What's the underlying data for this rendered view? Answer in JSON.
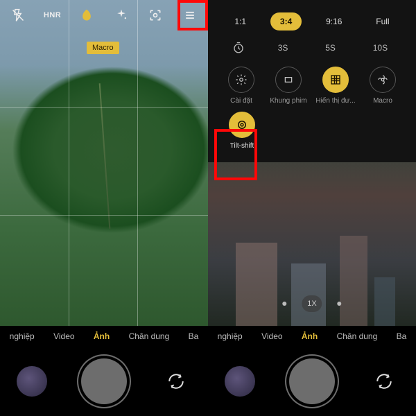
{
  "accent": "#e3bd3a",
  "left": {
    "top_icons": [
      "flash-off",
      "hdr",
      "leaf",
      "sparkle",
      "lens",
      "menu"
    ],
    "hdr_text": "HNR",
    "mode_badge": "Macro",
    "modes": [
      "nghiệp",
      "Video",
      "Ảnh",
      "Chân dung",
      "Ba"
    ],
    "active_mode": "Ảnh"
  },
  "right": {
    "ratios": [
      "1:1",
      "3:4",
      "9:16",
      "Full"
    ],
    "active_ratio": "3:4",
    "timers": [
      "3S",
      "5S",
      "10S"
    ],
    "options_row1": [
      {
        "key": "caidat",
        "label": "Cài đặt",
        "icon": "gear"
      },
      {
        "key": "khungphim",
        "label": "Khung phim",
        "icon": "frame"
      },
      {
        "key": "hienthi",
        "label": "Hiển thị đư...",
        "icon": "grid",
        "active": true
      },
      {
        "key": "macro",
        "label": "Macro",
        "icon": "flower"
      }
    ],
    "options_row2": [
      {
        "key": "tiltshift",
        "label": "Tilt-shift",
        "icon": "target",
        "active": true
      }
    ],
    "zoom_options": [
      "",
      "1X",
      ""
    ],
    "modes": [
      "nghiệp",
      "Video",
      "Ảnh",
      "Chân dung",
      "Ba"
    ],
    "active_mode": "Ảnh"
  }
}
